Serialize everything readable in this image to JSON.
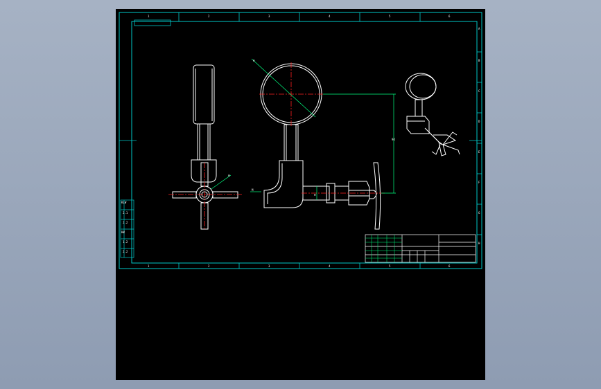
{
  "viewer": {
    "background": "#000000",
    "frame_color": "#00c8c8",
    "geometry_color": "#ffffff",
    "centerline_color": "#ff2020",
    "dimension_color": "#00ff80"
  },
  "border_zones": {
    "columns": [
      "1",
      "2",
      "3",
      "4",
      "5",
      "6"
    ],
    "rows": [
      "A",
      "B",
      "C",
      "D",
      "E",
      "F",
      "G",
      "H"
    ]
  },
  "dimensions": {
    "gauge_diameter": "Φ",
    "knob_diameter": "Φ",
    "shaft": "Φ",
    "fitting": "M",
    "vertical": "94"
  },
  "side_table": [
    "KLW",
    "2.1",
    "2.2",
    "HW",
    "1.2",
    "2.2"
  ]
}
